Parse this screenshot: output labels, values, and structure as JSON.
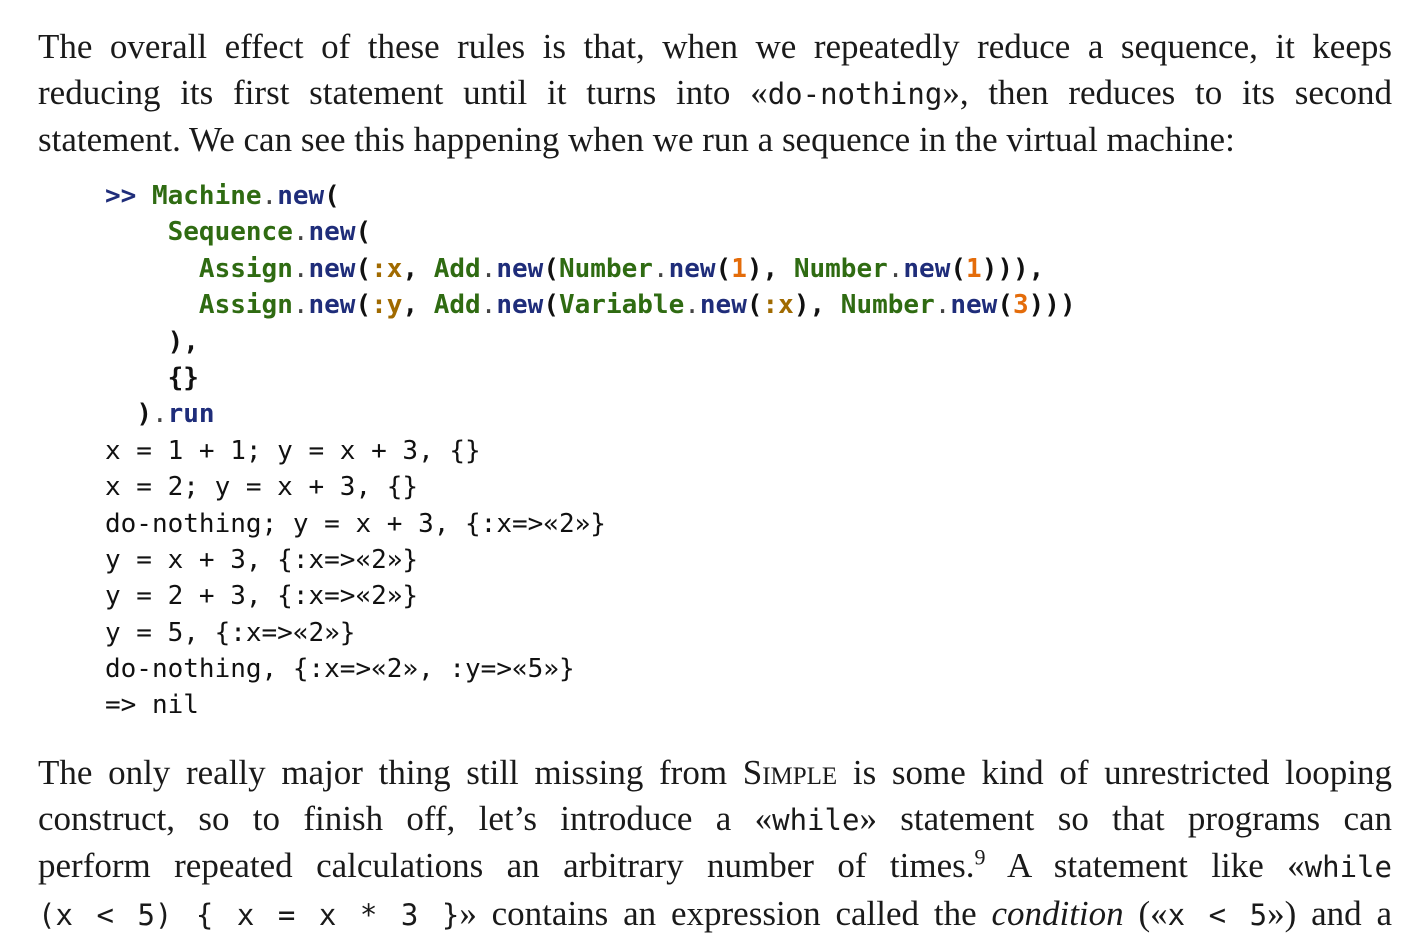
{
  "para1": {
    "line1": "The overall effect of these rules is that, when we repeatedly reduce a sequence, it keeps",
    "line2_a": "reducing its first statement until it turns into «",
    "line2_code": "do-nothing",
    "line2_b": "», then reduces to its second",
    "line3": "statement. We can see this happening when we run a sequence in the virtual machine:"
  },
  "code": {
    "prompt": ">>",
    "machine": "Machine",
    "new": "new",
    "sequence": "Sequence",
    "assign": "Assign",
    "add": "Add",
    "number": "Number",
    "variable": "Variable",
    "sym_x": ":x",
    "sym_y": ":y",
    "one": "1",
    "three": "3",
    "run": "run",
    "empty_env": "{}",
    "output": [
      "x = 1 + 1; y = x + 3, {}",
      "x = 2; y = x + 3, {}",
      "do-nothing; y = x + 3, {:x=>«2»}",
      "y = x + 3, {:x=>«2»}",
      "y = 2 + 3, {:x=>«2»}",
      "y = 5, {:x=>«2»}",
      "do-nothing, {:x=>«2», :y=>«5»}",
      "=> nil"
    ]
  },
  "para2": {
    "line1_a": "The only really major thing still missing from ",
    "line1_sc": "Simple",
    "line1_b": " is some kind of unrestricted looping",
    "line2_a": "construct, so to finish off, let’s introduce a «",
    "line2_code": "while",
    "line2_b": "» statement so that programs can",
    "line3_a": "perform repeated calculations an arbitrary number of times.",
    "line3_sup": "9",
    "line3_b": " A statement like «",
    "line3_code": "while",
    "line4_code": "(x < 5) { x = x * 3 }",
    "line4_a": "» contains an expression called the ",
    "line4_em": "condition",
    "line4_b": " («",
    "line4_code2": "x < 5",
    "line4_c": "») and a"
  }
}
